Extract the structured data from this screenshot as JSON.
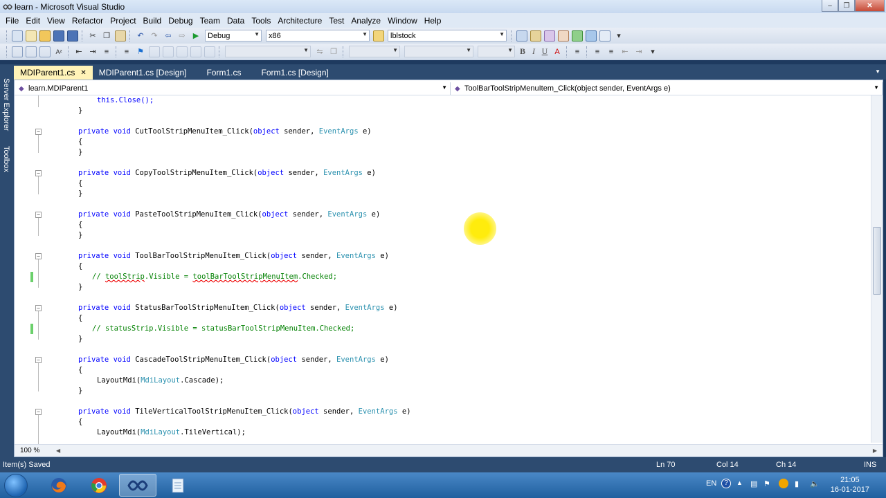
{
  "window": {
    "title": "learn - Microsoft Visual Studio"
  },
  "menu": [
    "File",
    "Edit",
    "View",
    "Refactor",
    "Project",
    "Build",
    "Debug",
    "Team",
    "Data",
    "Tools",
    "Architecture",
    "Test",
    "Analyze",
    "Window",
    "Help"
  ],
  "toolbar": {
    "configuration": "Debug",
    "platform": "x86",
    "find_value": "lblstock"
  },
  "side_panels": [
    "Server Explorer",
    "Toolbox"
  ],
  "tabs": [
    {
      "label": "MDIParent1.cs",
      "active": true
    },
    {
      "label": "MDIParent1.cs [Design]",
      "active": false
    },
    {
      "label": "Form1.cs",
      "active": false
    },
    {
      "label": "Form1.cs [Design]",
      "active": false
    }
  ],
  "navigation": {
    "type_combo": "learn.MDIParent1",
    "member_combo": "ToolBarToolStripMenuItem_Click(object sender, EventArgs e)"
  },
  "code_lines": [
    "this.Close();",
    "}",
    "private void CutToolStripMenuItem_Click(object sender, EventArgs e)",
    "{",
    "}",
    "private void CopyToolStripMenuItem_Click(object sender, EventArgs e)",
    "{",
    "}",
    "private void PasteToolStripMenuItem_Click(object sender, EventArgs e)",
    "{",
    "}",
    "private void ToolBarToolStripMenuItem_Click(object sender, EventArgs e)",
    "{",
    "// toolStrip.Visible = toolBarToolStripMenuItem.Checked;",
    "}",
    "private void StatusBarToolStripMenuItem_Click(object sender, EventArgs e)",
    "{",
    "// statusStrip.Visible = statusBarToolStripMenuItem.Checked;",
    "}",
    "private void CascadeToolStripMenuItem_Click(object sender, EventArgs e)",
    "{",
    "LayoutMdi(MdiLayout.Cascade);",
    "}",
    "private void TileVerticalToolStripMenuItem_Click(object sender, EventArgs e)",
    "{",
    "LayoutMdi(MdiLayout.TileVertical);"
  ],
  "editor": {
    "zoom": "100 %"
  },
  "status": {
    "message": "Item(s) Saved",
    "line": "Ln 70",
    "col": "Col 14",
    "ch": "Ch 14",
    "mode": "INS"
  },
  "taskbar": {
    "language": "EN",
    "time": "21:05",
    "date": "16-01-2017"
  },
  "colors": {
    "keyword": "#0000ff",
    "type": "#2b91af",
    "comment": "#008000",
    "active_tab": "#fff3b8",
    "chrome": "#2d4b70"
  }
}
